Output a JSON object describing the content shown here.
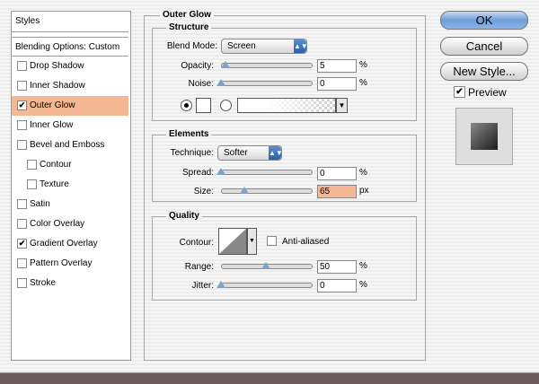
{
  "styles_panel": {
    "header": "Styles",
    "blending_options": "Blending Options: Custom",
    "items": [
      {
        "label": "Drop Shadow",
        "checked": false,
        "indent": false,
        "selected": false
      },
      {
        "label": "Inner Shadow",
        "checked": false,
        "indent": false,
        "selected": false
      },
      {
        "label": "Outer Glow",
        "checked": true,
        "indent": false,
        "selected": true
      },
      {
        "label": "Inner Glow",
        "checked": false,
        "indent": false,
        "selected": false
      },
      {
        "label": "Bevel and Emboss",
        "checked": false,
        "indent": false,
        "selected": false
      },
      {
        "label": "Contour",
        "checked": false,
        "indent": true,
        "selected": false
      },
      {
        "label": "Texture",
        "checked": false,
        "indent": true,
        "selected": false
      },
      {
        "label": "Satin",
        "checked": false,
        "indent": false,
        "selected": false
      },
      {
        "label": "Color Overlay",
        "checked": false,
        "indent": false,
        "selected": false
      },
      {
        "label": "Gradient Overlay",
        "checked": true,
        "indent": false,
        "selected": false
      },
      {
        "label": "Pattern Overlay",
        "checked": false,
        "indent": false,
        "selected": false
      },
      {
        "label": "Stroke",
        "checked": false,
        "indent": false,
        "selected": false
      }
    ]
  },
  "outer_glow": {
    "title": "Outer Glow",
    "structure": {
      "title": "Structure",
      "blend_mode_label": "Blend Mode:",
      "blend_mode_value": "Screen",
      "opacity_label": "Opacity:",
      "opacity_value": "5",
      "opacity_level": 5,
      "noise_label": "Noise:",
      "noise_value": "0",
      "noise_level": 0,
      "percent": "%"
    },
    "elements": {
      "title": "Elements",
      "technique_label": "Technique:",
      "technique_value": "Softer",
      "spread_label": "Spread:",
      "spread_value": "0",
      "spread_level": 0,
      "size_label": "Size:",
      "size_value": "65",
      "size_level": 26,
      "percent": "%",
      "px": "px"
    },
    "quality": {
      "title": "Quality",
      "contour_label": "Contour:",
      "anti_aliased_label": "Anti-aliased",
      "anti_aliased_checked": false,
      "range_label": "Range:",
      "range_value": "50",
      "range_level": 50,
      "jitter_label": "Jitter:",
      "jitter_value": "0",
      "jitter_level": 0,
      "percent": "%"
    }
  },
  "buttons": {
    "ok": "OK",
    "cancel": "Cancel",
    "new_style": "New Style..."
  },
  "preview": {
    "label": "Preview",
    "checked": true
  },
  "colors": {
    "selection": "#f4b894",
    "accent": "#5a8ed0"
  }
}
